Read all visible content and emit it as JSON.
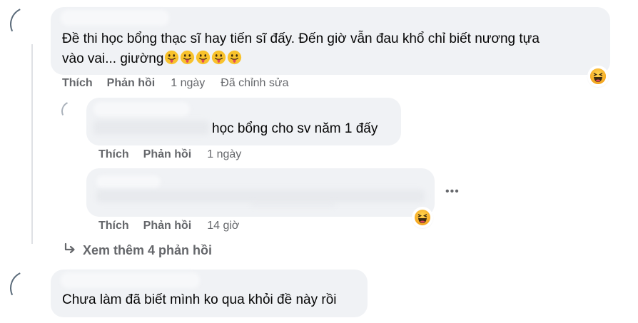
{
  "comments": [
    {
      "text": "Đề thi học bổng thạc sĩ hay tiến sĩ đấy. Đến giờ vẫn đau khổ chỉ biết nương tựa",
      "text_line2": "vào vai... giường",
      "emoji_name": "tongue-out-emoji",
      "emoji_count": 5,
      "like": "Thích",
      "reply": "Phản hồi",
      "time": "1 ngày",
      "edited": "Đã chỉnh sửa",
      "reaction": "haha-reaction-icon"
    },
    {
      "text": "học bổng cho sv năm 1 đấy",
      "like": "Thích",
      "reply": "Phản hồi",
      "time": "1 ngày"
    },
    {
      "more": "•••",
      "like": "Thích",
      "reply": "Phản hồi",
      "time": "14 giờ",
      "reaction": "haha-reaction-icon"
    }
  ],
  "view_more": {
    "icon": "reply-arrow-icon",
    "label": "Xem thêm 4 phản hồi"
  },
  "last_comment": {
    "text": "Chưa làm đã biết mình ko qua khỏi đề này rồi"
  },
  "colors": {
    "bubble": "#f0f2f5",
    "meta_text": "#65676b",
    "body_text": "#050505"
  }
}
